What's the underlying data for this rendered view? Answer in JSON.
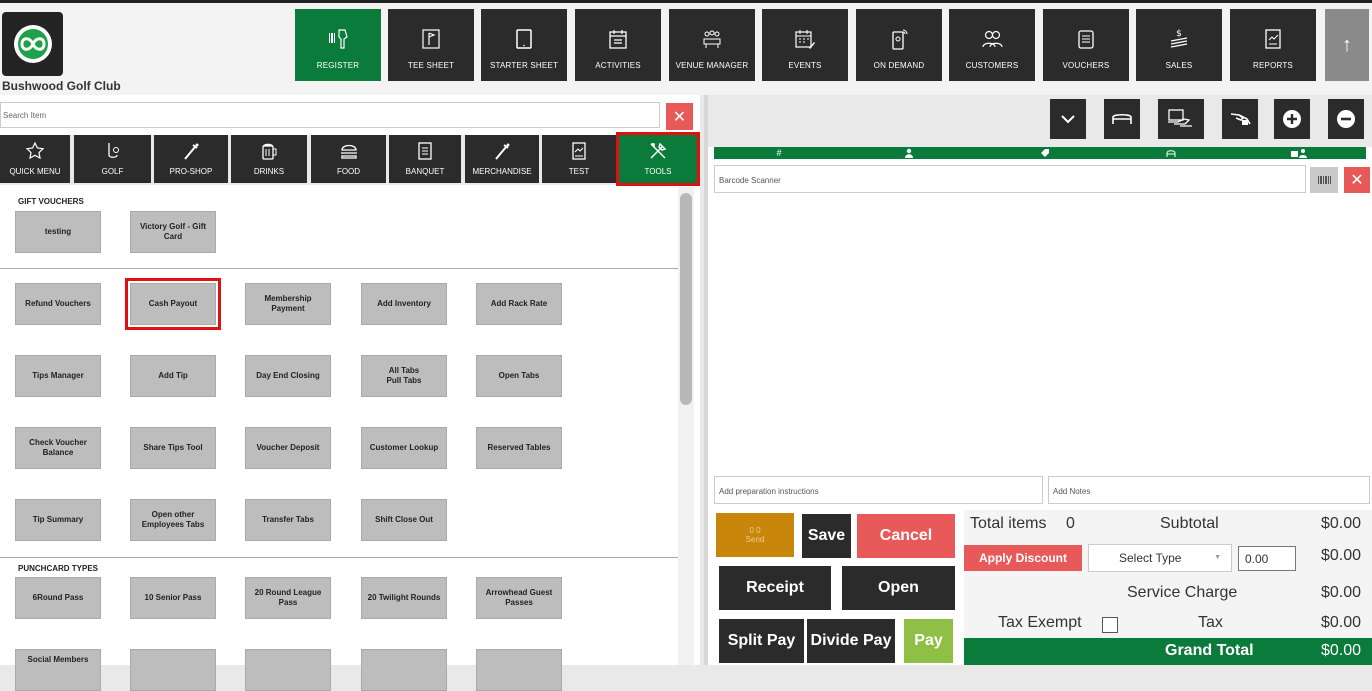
{
  "club_name": "Bushwood Golf Club",
  "nav": [
    {
      "label": "REGISTER",
      "icon": "barcode-scanner-icon",
      "active": true
    },
    {
      "label": "TEE SHEET",
      "icon": "flag-board-icon"
    },
    {
      "label": "STARTER SHEET",
      "icon": "tablet-icon"
    },
    {
      "label": "ACTIVITIES",
      "icon": "calendar-list-icon"
    },
    {
      "label": "VENUE MANAGER",
      "icon": "people-table-icon"
    },
    {
      "label": "EVENTS",
      "icon": "calendar-edit-icon"
    },
    {
      "label": "ON DEMAND",
      "icon": "phone-signal-icon"
    },
    {
      "label": "CUSTOMERS",
      "icon": "users-icon"
    },
    {
      "label": "VOUCHERS",
      "icon": "voucher-icon"
    },
    {
      "label": "SALES",
      "icon": "cash-icon"
    },
    {
      "label": "REPORTS",
      "icon": "report-icon"
    }
  ],
  "search": {
    "placeholder": "Search Item"
  },
  "categories": [
    {
      "label": "QUICK MENU",
      "icon": "star-icon"
    },
    {
      "label": "GOLF",
      "icon": "golf-club-icon"
    },
    {
      "label": "PRO-SHOP",
      "icon": "golf-bag-icon"
    },
    {
      "label": "DRINKS",
      "icon": "beer-icon"
    },
    {
      "label": "FOOD",
      "icon": "burger-icon"
    },
    {
      "label": "BANQUET",
      "icon": "document-icon"
    },
    {
      "label": "MERCHANDISE",
      "icon": "golf-bag-icon"
    },
    {
      "label": "TEST",
      "icon": "chart-doc-icon"
    },
    {
      "label": "TOOLS",
      "icon": "tools-icon",
      "active": true
    }
  ],
  "sections": {
    "gift_vouchers": "GIFT VOUCHERS",
    "punchcard_types": "PUNCHCARD TYPES"
  },
  "gift_buttons": [
    "testing",
    "Victory Golf - Gift Card"
  ],
  "tool_buttons": [
    [
      "Refund Vouchers",
      "Cash Payout",
      "Membership Payment",
      "Add Inventory",
      "Add Rack Rate"
    ],
    [
      "Tips Manager",
      "Add Tip",
      "Day End Closing",
      "All Tabs\nPull Tabs",
      "Open Tabs"
    ],
    [
      "Check Voucher Balance",
      "Share Tips Tool",
      "Voucher Deposit",
      "Customer Lookup",
      "Reserved Tables"
    ],
    [
      "Tip Summary",
      "Open other Employees Tabs",
      "Transfer Tabs",
      "Shift Close Out"
    ]
  ],
  "punch_buttons": [
    "6Round Pass",
    "10 Senior Pass",
    "20 Round League Pass",
    "20 Twilight Rounds",
    "Arrowhead Guest Passes"
  ],
  "partial_button": "Social Members",
  "order": {
    "barcode_placeholder": "Barcode Scanner",
    "prep_placeholder": "Add preparation instructions",
    "notes_placeholder": "Add Notes",
    "send_counts": "0   0",
    "send_label": "Send",
    "save": "Save",
    "cancel": "Cancel",
    "receipt": "Receipt",
    "open": "Open",
    "split_pay": "Split Pay",
    "divide_pay": "Divide Pay",
    "pay": "Pay"
  },
  "totals": {
    "total_items_label": "Total items",
    "total_items": "0",
    "subtotal_label": "Subtotal",
    "subtotal": "$0.00",
    "apply_discount": "Apply Discount",
    "select_type": "Select Type",
    "discount_value": "0.00",
    "discount_amount": "$0.00",
    "service_charge_label": "Service Charge",
    "service_charge": "$0.00",
    "tax_exempt_label": "Tax Exempt",
    "tax_label": "Tax",
    "tax": "$0.00",
    "grand_total_label": "Grand Total",
    "grand_total": "$0.00"
  },
  "colors": {
    "brand_green": "#0a7b3b",
    "dark": "#2c2b2b",
    "danger": "#e85a5a",
    "send": "#c8860a",
    "pay": "#8fc045"
  }
}
